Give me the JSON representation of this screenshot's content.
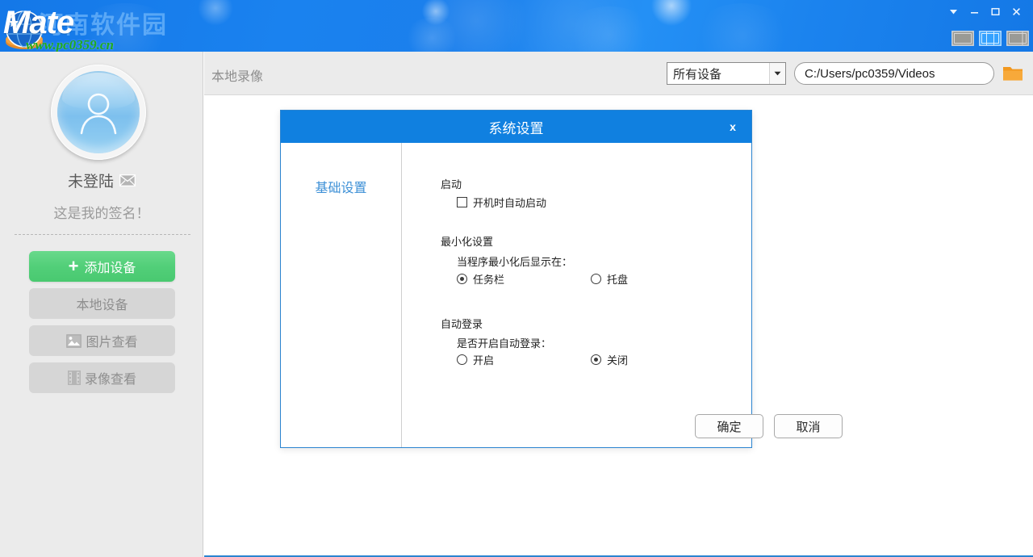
{
  "titlebar": {
    "watermark_text": "Mate",
    "watermark_cn": "河南软件园",
    "watermark_url": "www.pc0359.cn",
    "controls": [
      {
        "name": "dropdown-menu-button",
        "glyph": "down-triangle-icon"
      },
      {
        "name": "minimize-button",
        "glyph": "minimize-icon"
      },
      {
        "name": "maximize-button",
        "glyph": "maximize-icon"
      },
      {
        "name": "close-button",
        "glyph": "close-icon"
      }
    ],
    "layout_buttons": [
      {
        "name": "layout-single-button"
      },
      {
        "name": "layout-split-button"
      },
      {
        "name": "layout-wide-button"
      }
    ],
    "accent": "#1b7fec"
  },
  "sidebar": {
    "user_name": "未登陆",
    "mail_icon": "envelope-icon",
    "signature": "这是我的签名！",
    "buttons": [
      {
        "label": "添加设备",
        "icon": "plus-icon",
        "style": "primary"
      },
      {
        "label": "本地设备",
        "icon": "none",
        "style": "gray"
      },
      {
        "label": "图片查看",
        "icon": "image-icon",
        "style": "gray"
      },
      {
        "label": "录像查看",
        "icon": "film-icon",
        "style": "gray"
      }
    ],
    "bg": "#ebebeb"
  },
  "toolbar": {
    "title": "本地录像",
    "device_filter": {
      "selected": "所有设备",
      "options": [
        "所有设备"
      ],
      "arrow_icon": "chevron-down-icon"
    },
    "path": {
      "value": "C:/Users/pc0359/Videos",
      "placeholder": "C:/Users/pc0359/Videos"
    },
    "folder_button_icon": "folder-icon",
    "folder_color": "#f2981f"
  },
  "dialog": {
    "title": "系统设置",
    "close_label": "x",
    "nav": [
      {
        "label": "基础设置",
        "active": true
      }
    ],
    "groups": [
      {
        "title": "启动",
        "checkbox": {
          "label": "开机时自动启动",
          "checked": false
        }
      },
      {
        "title": "最小化设置",
        "sub_label": "当程序最小化后显示在：",
        "radios": [
          {
            "label": "任务栏",
            "checked": true
          },
          {
            "label": "托盘",
            "checked": false
          }
        ]
      },
      {
        "title": "自动登录",
        "sub_label": "是否开启自动登录：",
        "radios": [
          {
            "label": "开启",
            "checked": false
          },
          {
            "label": "关闭",
            "checked": true
          }
        ]
      }
    ],
    "buttons": [
      {
        "label": "确定",
        "name": "ok-button"
      },
      {
        "label": "取消",
        "name": "cancel-button"
      }
    ],
    "header_color": "#1080e0",
    "border_color": "#2b84d0"
  }
}
